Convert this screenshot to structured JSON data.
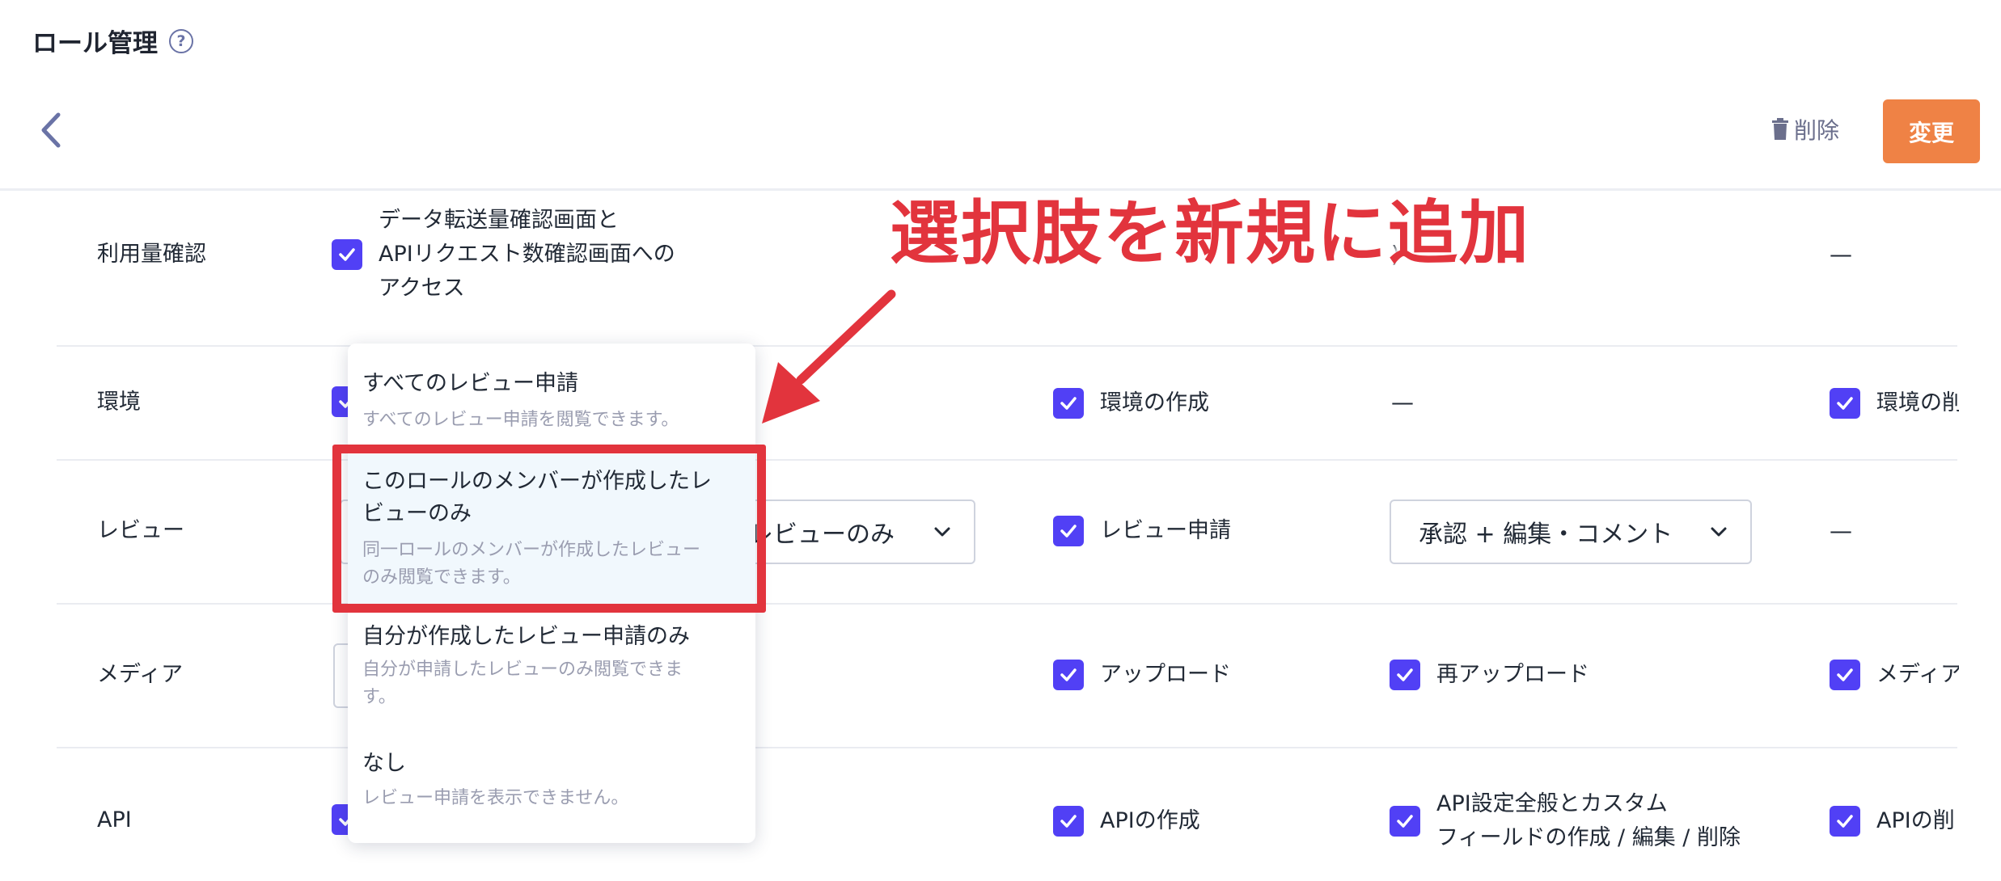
{
  "header": {
    "title": "ロール管理",
    "help": "?",
    "delete_label": "削除",
    "change_label": "変更"
  },
  "rows": {
    "usage": {
      "label": "利用量確認",
      "col1_lines": [
        "データ転送量確認画面と",
        "APIリクエスト数確認画面への",
        "アクセス"
      ],
      "col5": "—"
    },
    "environment": {
      "label": "環境",
      "col3": "環境の作成",
      "col4": "—",
      "col5": "環境の削"
    },
    "review": {
      "label": "レビュー",
      "select1": "レビューのみ",
      "col3": "レビュー申請",
      "select2": "承認 + 編集・コメント",
      "col5": "—"
    },
    "media": {
      "label": "メディア",
      "col3": "アップロード",
      "col4": "再アップロード",
      "col5": "メディア"
    },
    "api": {
      "label": "API",
      "col3": "APIの作成",
      "col4_lines": [
        "API設定全般とカスタム",
        "フィールドの作成 / 編集 / 削除"
      ],
      "col5": "APIの削"
    }
  },
  "dropdown": {
    "options": [
      {
        "title": "すべてのレビュー申請",
        "desc": "すべてのレビュー申請を閲覧できます。"
      },
      {
        "title_lines": [
          "このロールのメンバーが作成したレ",
          "ビューのみ"
        ],
        "desc_lines": [
          "同一ロールのメンバーが作成したレビュー",
          "のみ閲覧できます。"
        ]
      },
      {
        "title": "自分が作成したレビュー申請のみ",
        "desc_lines": [
          "自分が申請したレビューのみ閲覧できま",
          "す。"
        ]
      },
      {
        "title": "なし",
        "desc": "レビュー申請を表示できません。"
      }
    ]
  },
  "annotation": {
    "text": "選択肢を新規に追加",
    "color": "#e2343d"
  },
  "colors": {
    "accent": "#5140f5",
    "primary_button": "#ef8245"
  }
}
